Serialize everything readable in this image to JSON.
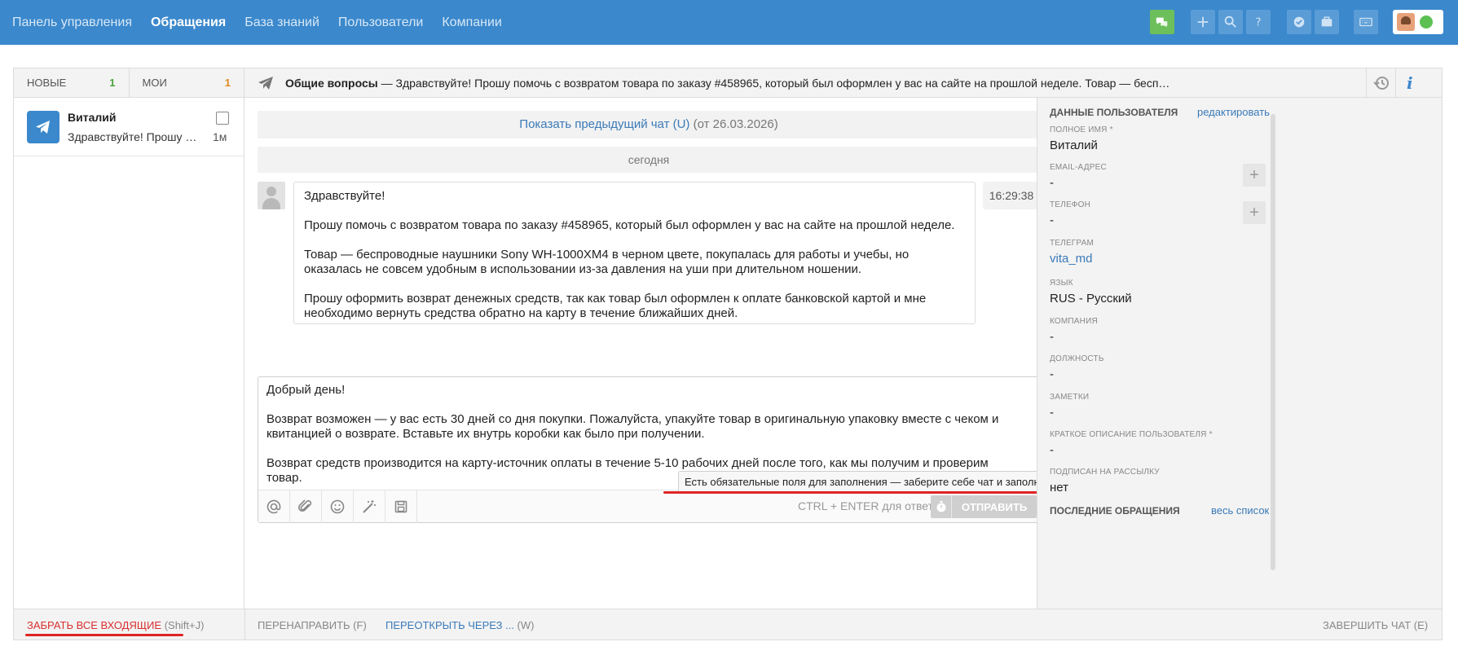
{
  "nav": {
    "items": [
      "Панель управления",
      "Обращения",
      "База знаний",
      "Пользователи",
      "Компании"
    ],
    "active": "Обращения"
  },
  "toolbar_icons": [
    "chats-icon",
    "plus-icon",
    "search-icon",
    "help-icon",
    "check-icon",
    "briefcase-icon",
    "keyboard-icon",
    "avatar",
    "status-online"
  ],
  "colors": {
    "topbar": "#3b88cc",
    "accent": "#3b7ab8",
    "green": "#4ca23a",
    "orange": "#e08a1e",
    "red": "#d93030"
  },
  "tabs": {
    "new_label": "НОВЫЕ",
    "new_count": "1",
    "mine_label": "МОИ",
    "mine_count": "1"
  },
  "chat_list": [
    {
      "name": "Виталий",
      "preview": "Здравствуйте! Прошу помочь с возвратом товара",
      "time": "1м"
    }
  ],
  "header": {
    "category": "Общие вопросы",
    "dash": " — ",
    "snippet": "Здравствуйте! Прошу помочь с возвратом товара по заказу #458965, который был оформлен у вас на сайте на прошлой неделе. Товар — бесп…"
  },
  "conversation": {
    "prev_link": "Показать предыдущий чат (U)",
    "prev_date": " (от 26.03.2026)",
    "day_divider": "сегодня",
    "message": {
      "time": "16:29:38",
      "paragraphs": [
        "Здравствуйте!",
        "Прошу помочь с возвратом товара по заказу #458965, который был оформлен у вас на сайте на прошлой неделе.",
        "Товар — беспроводные наушники Sony WH-1000XM4 в черном цвете, покупалась для работы и учебы, но оказалась не совсем удобным в использовании из-за давления на уши при длительном ношении.",
        "Прошу оформить возврат денежных средств, так как товар был оформлен к оплате банковской картой и мне необходимо вернуть средства обратно на карту в течение ближайших дней."
      ]
    }
  },
  "reply": {
    "paragraphs": [
      "Добрый день!",
      "Возврат возможен — у вас есть 30 дней со дня покупки. Пожалуйста, упакуйте товар в оригинальную упаковку вместе с чеком и квитанцией о возврате. Вставьте их внутрь коробки как было при получении.",
      "Возврат средств производится на карту-источник оплаты в течение 5-10 рабочих дней после того, как мы получим и проверим товар."
    ],
    "tooltip": "Есть обязательные поля для заполнения — заберите себе чат и заполните поля",
    "hint": "CTRL + ENTER для ответа",
    "send_label": "ОТПРАВИТЬ"
  },
  "user_panel": {
    "title": "ДАННЫЕ ПОЛЬЗОВАТЕЛЯ",
    "edit": "редактировать",
    "fields": [
      {
        "label": "ПОЛНОЕ ИМЯ *",
        "value": "Виталий"
      },
      {
        "label": "EMAIL-АДРЕС",
        "value": "-"
      },
      {
        "label": "ТЕЛЕФОН",
        "value": "-"
      },
      {
        "label": "ТЕЛЕГРАМ",
        "value": "vita_md"
      },
      {
        "label": "ЯЗЫК",
        "value": "RUS - Русский"
      },
      {
        "label": "КОМПАНИЯ",
        "value": "-"
      },
      {
        "label": "ДОЛЖНОСТЬ",
        "value": "-"
      },
      {
        "label": "ЗАМЕТКИ",
        "value": "-"
      },
      {
        "label": "КРАТКОЕ ОПИСАНИЕ ПОЛЬЗОВАТЕЛЯ *",
        "value": "-"
      },
      {
        "label": "ПОДПИСАН НА РАССЫЛКУ",
        "value": "нет"
      }
    ],
    "recent_title": "ПОСЛЕДНИЕ ОБРАЩЕНИЯ",
    "recent_all": "весь список"
  },
  "bottom": {
    "take_all": "ЗАБРАТЬ ВСЕ ВХОДЯЩИЕ",
    "take_all_shortcut": " (Shift+J)",
    "forward": "ПЕРЕНАПРАВИТЬ (F)",
    "reopen": "ПЕРЕОТКРЫТЬ ЧЕРЕЗ ...",
    "reopen_shortcut": " (W)",
    "end": "ЗАВЕРШИТЬ ЧАТ (E)"
  }
}
